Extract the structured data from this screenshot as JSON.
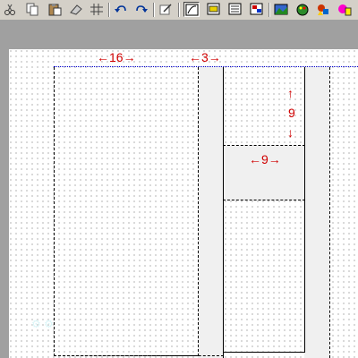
{
  "toolbar": {
    "buttons": [
      {
        "name": "cut-icon",
        "pressed": false
      },
      {
        "name": "copy-icon",
        "pressed": false
      },
      {
        "name": "paste-icon",
        "pressed": false
      },
      {
        "name": "eraser-icon",
        "pressed": false
      },
      {
        "name": "grid-icon",
        "pressed": false
      },
      {
        "name": "undo-icon",
        "pressed": false
      },
      {
        "name": "redo-icon",
        "pressed": false
      },
      {
        "name": "edit-properties-icon",
        "pressed": false
      },
      {
        "name": "view-mode-1-icon",
        "pressed": true
      },
      {
        "name": "view-mode-2-icon",
        "pressed": false
      },
      {
        "name": "view-mode-3-icon",
        "pressed": false
      },
      {
        "name": "view-mode-4-icon",
        "pressed": false
      },
      {
        "name": "image-icon",
        "pressed": false
      },
      {
        "name": "color-palette-icon",
        "pressed": false
      },
      {
        "name": "shapes-icon",
        "pressed": false
      },
      {
        "name": "paint-icon",
        "pressed": false
      }
    ]
  },
  "dimensions": {
    "left_width": "16",
    "gap_width": "3",
    "block_height": "9",
    "inner_width": "9"
  },
  "colors": {
    "dimension_text": "#d00000",
    "canvas": "#ffffff",
    "strip": "#f0f0f0",
    "frame": "#a0a0a0",
    "guide": "#0000cc"
  }
}
